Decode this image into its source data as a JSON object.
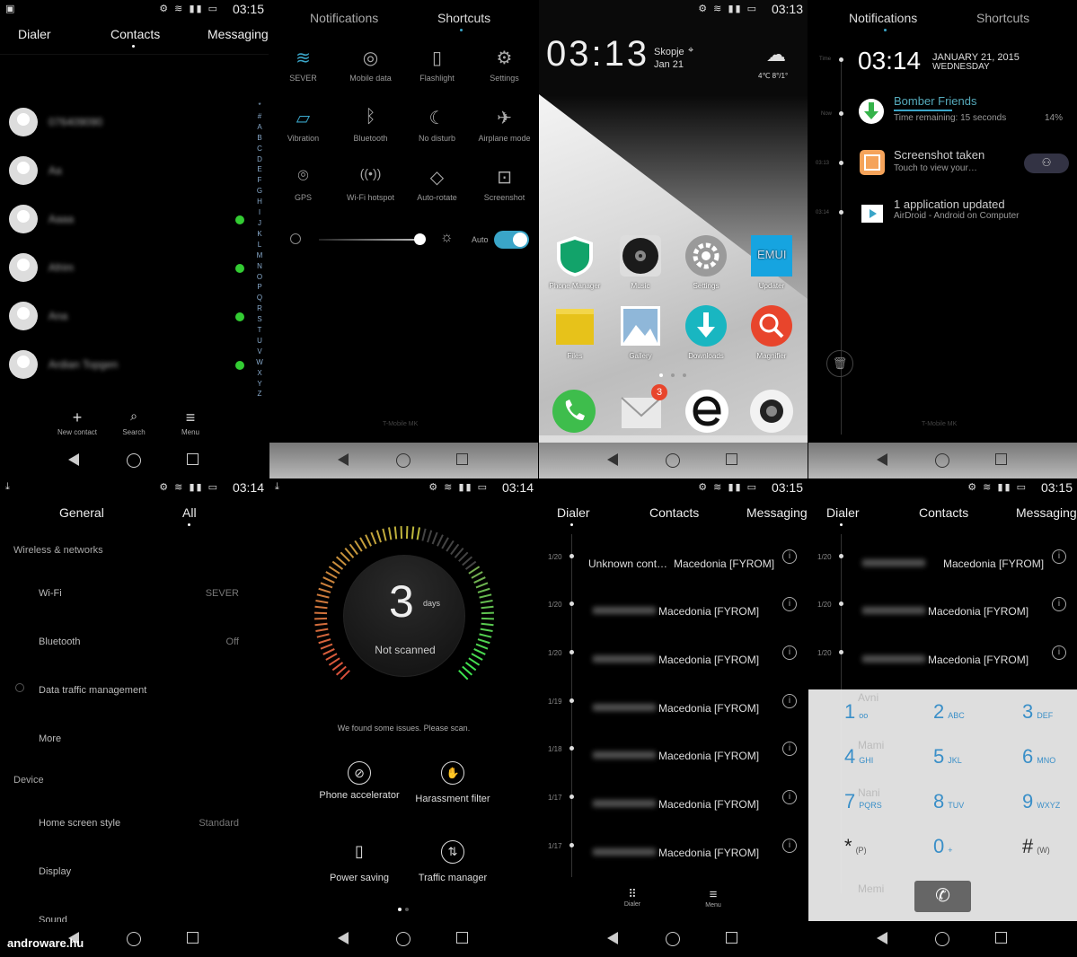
{
  "status": {
    "t1": "03:15",
    "t2": "",
    "t3": "03:13",
    "t4": "",
    "t5": "03:14",
    "t6": "03:14",
    "t7": "03:15",
    "t8": "03:15"
  },
  "p1": {
    "tabs": [
      "Dialer",
      "Contacts",
      "Messaging"
    ],
    "contacts": [
      "076409090",
      "Aa",
      "Aaaa",
      "Afrim",
      "Ana",
      "Ardian Topgen"
    ],
    "alphabet": "*#ABCDEFGHIJKLMNOPQRSTUVWXYZ",
    "bottom": [
      "New contact",
      "Search",
      "Menu"
    ]
  },
  "p2": {
    "tabs": [
      "Notifications",
      "Shortcuts"
    ],
    "tiles": [
      "SEVER",
      "Mobile data",
      "Flashlight",
      "Settings",
      "Vibration",
      "Bluetooth",
      "No disturb",
      "Airplane mode",
      "GPS",
      "Wi-Fi hotspot",
      "Auto-rotate",
      "Screenshot"
    ],
    "auto": "Auto",
    "carrier": "T-Mobile MK"
  },
  "p3": {
    "time": "03:13",
    "city": "Skopje",
    "date": "Jan 21",
    "temp": "4℃ 8°/1°",
    "apps": [
      "Phone Manager",
      "Music",
      "Settings",
      "Updater",
      "Files",
      "Gallery",
      "Downloads",
      "Magnifier"
    ],
    "emui": "EMUI",
    "badge": "3"
  },
  "p4": {
    "tabs": [
      "Notifications",
      "Shortcuts"
    ],
    "time": "03:14",
    "date": "JANUARY 21, 2015",
    "day": "WEDNESDAY",
    "tl_labels": [
      "Time",
      "Now",
      "03:13",
      "03:14"
    ],
    "n1_title": "Bomber Friends",
    "n1_sub": "Time remaining: 15 seconds",
    "n1_pct": "14%",
    "n2_title": "Screenshot taken",
    "n2_sub": "Touch to view your…",
    "n3_title": "1 application updated",
    "n3_sub": "AirDroid - Android on Computer",
    "carrier": "T-Mobile MK"
  },
  "p5": {
    "tabs": [
      "General",
      "All"
    ],
    "sec1": "Wireless & networks",
    "rows": [
      {
        "label": "Wi-Fi",
        "value": "SEVER"
      },
      {
        "label": "Bluetooth",
        "value": "Off"
      },
      {
        "label": "Data traffic management",
        "value": ""
      },
      {
        "label": "More",
        "value": ""
      }
    ],
    "sec2": "Device",
    "rows2": [
      {
        "label": "Home screen style",
        "value": "Standard"
      },
      {
        "label": "Display",
        "value": ""
      },
      {
        "label": "Sound",
        "value": ""
      }
    ]
  },
  "p6": {
    "num": "3",
    "unit": "days",
    "status": "Not scanned",
    "msg": "We found some issues. Please scan.",
    "tools": [
      "Phone accelerator",
      "Harassment filter",
      "Power saving",
      "Traffic manager"
    ]
  },
  "p7": {
    "tabs": [
      "Dialer",
      "Contacts",
      "Messaging"
    ],
    "dates": [
      "1/20",
      "1/20",
      "1/20",
      "1/19",
      "1/18",
      "1/17",
      "1/17"
    ],
    "first_name": "Unknown cont…",
    "loc": "Macedonia [FYROM]",
    "bottom": [
      "Dialer",
      "Menu"
    ]
  },
  "p8": {
    "tabs": [
      "Dialer",
      "Contacts",
      "Messaging"
    ],
    "dates": [
      "1/20",
      "1/20",
      "1/20"
    ],
    "loc": "Macedonia [FYROM]",
    "keys": [
      {
        "d": "1",
        "l": "oo"
      },
      {
        "d": "2",
        "l": "ABC"
      },
      {
        "d": "3",
        "l": "DEF"
      },
      {
        "d": "4",
        "l": "GHI"
      },
      {
        "d": "5",
        "l": "JKL"
      },
      {
        "d": "6",
        "l": "MNO"
      },
      {
        "d": "7",
        "l": "PQRS"
      },
      {
        "d": "8",
        "l": "TUV"
      },
      {
        "d": "9",
        "l": "WXYZ"
      },
      {
        "d": "*",
        "l": "(P)"
      },
      {
        "d": "0",
        "l": "+"
      },
      {
        "d": "#",
        "l": "(W)"
      }
    ],
    "ghosts": [
      "Avni",
      "Mami",
      "Nani",
      "Memi"
    ]
  },
  "watermark": "androware.hu"
}
